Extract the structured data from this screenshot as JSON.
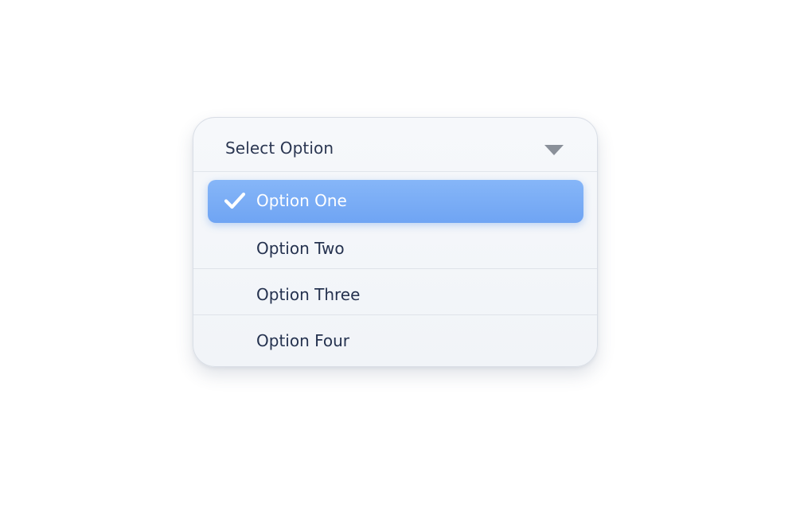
{
  "dropdown": {
    "title": "Select Option",
    "caret_icon": "caret-down-icon",
    "options": [
      {
        "label": "Option One",
        "selected": true,
        "icon": "check-icon"
      },
      {
        "label": "Option Two",
        "selected": false
      },
      {
        "label": "Option Three",
        "selected": false
      },
      {
        "label": "Option Four",
        "selected": false
      }
    ]
  },
  "colors": {
    "selected_background": "#7aadf6",
    "selected_text": "#ffffff",
    "option_text": "#25324f",
    "panel_background": "#f4f6f9",
    "caret": "#8a9099"
  }
}
